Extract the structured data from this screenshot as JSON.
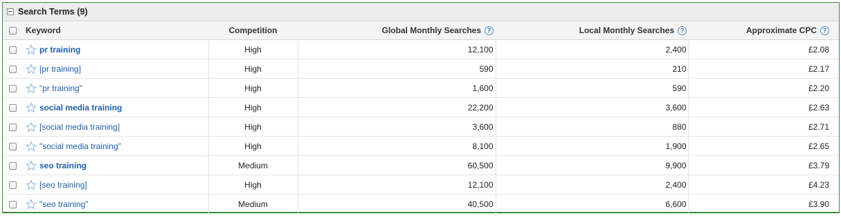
{
  "panel": {
    "title": "Search Terms (9)"
  },
  "columns": {
    "keyword": "Keyword",
    "competition": "Competition",
    "global": "Global Monthly Searches",
    "local": "Local Monthly Searches",
    "cpc": "Approximate CPC",
    "help_glyph": "?"
  },
  "colors": {
    "link": "#1f5fa8",
    "border_green": "#3b8a3b",
    "header_bg": "#ececec"
  },
  "rows": [
    {
      "keyword": "pr training",
      "match": "broad",
      "competition": "High",
      "global": "12,100",
      "local": "2,400",
      "cpc": "£2.08"
    },
    {
      "keyword": "[pr training]",
      "match": "exact",
      "competition": "High",
      "global": "590",
      "local": "210",
      "cpc": "£2.17"
    },
    {
      "keyword": "\"pr training\"",
      "match": "phrase",
      "competition": "High",
      "global": "1,600",
      "local": "590",
      "cpc": "£2.20"
    },
    {
      "keyword": "social media training",
      "match": "broad",
      "competition": "High",
      "global": "22,200",
      "local": "3,600",
      "cpc": "£2.63"
    },
    {
      "keyword": "[social media training]",
      "match": "exact",
      "competition": "High",
      "global": "3,600",
      "local": "880",
      "cpc": "£2.71"
    },
    {
      "keyword": "\"social media training\"",
      "match": "phrase",
      "competition": "High",
      "global": "8,100",
      "local": "1,900",
      "cpc": "£2.65"
    },
    {
      "keyword": "seo training",
      "match": "broad",
      "competition": "Medium",
      "global": "60,500",
      "local": "9,900",
      "cpc": "£3.79"
    },
    {
      "keyword": "[seo training]",
      "match": "exact",
      "competition": "High",
      "global": "12,100",
      "local": "2,400",
      "cpc": "£4.23"
    },
    {
      "keyword": "\"seo training\"",
      "match": "phrase",
      "competition": "Medium",
      "global": "40,500",
      "local": "6,600",
      "cpc": "£3.90"
    }
  ]
}
